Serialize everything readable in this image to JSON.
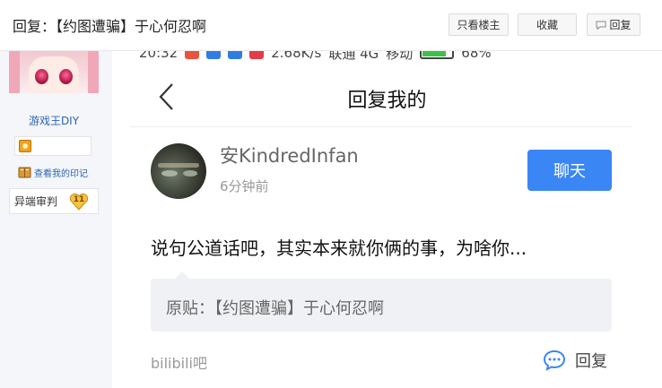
{
  "thread": {
    "title": "回复：【约图遭骗】于心何忍啊",
    "buttons": {
      "only_op": "只看楼主",
      "favorite": "收藏",
      "reply": "回复"
    }
  },
  "sidebar": {
    "username": "游戏王DIY",
    "record_link": "查看我的印记",
    "badge_label": "异端审判",
    "badge_level": "11"
  },
  "phone": {
    "status_bar": {
      "time": "20:32",
      "speed": "2.68K/s",
      "carrier1": "联通 4G",
      "carrier2": "移动",
      "battery": "68%"
    },
    "header_title": "回复我的",
    "reply": {
      "username": "安KindredInfan",
      "time": "6分钟前",
      "chat_button": "聊天",
      "text": "说句公道话吧，其实本来就你俩的事，为啥你...",
      "quote": "原贴：【约图遭骗】于心何忍啊",
      "forum": "bilibili吧",
      "reply_label": "回复"
    }
  },
  "colors": {
    "accent_blue": "#3a86f5",
    "link_blue": "#2d64b3",
    "quote_bg": "#f0f1f5",
    "sidebar_bg": "#f4f6fa"
  },
  "icons": {
    "back": "chevron-left-icon",
    "comment": "comment-bubble-icon",
    "level": "level-badge-icon",
    "book": "book-icon",
    "heart": "heart-badge-icon"
  }
}
